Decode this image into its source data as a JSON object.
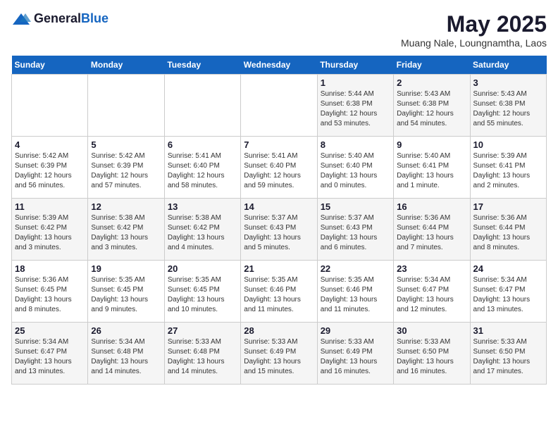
{
  "header": {
    "logo_general": "General",
    "logo_blue": "Blue",
    "title": "May 2025",
    "subtitle": "Muang Nale, Loungnamtha, Laos"
  },
  "weekdays": [
    "Sunday",
    "Monday",
    "Tuesday",
    "Wednesday",
    "Thursday",
    "Friday",
    "Saturday"
  ],
  "weeks": [
    [
      {
        "day": "",
        "sunrise": "",
        "sunset": "",
        "daylight": ""
      },
      {
        "day": "",
        "sunrise": "",
        "sunset": "",
        "daylight": ""
      },
      {
        "day": "",
        "sunrise": "",
        "sunset": "",
        "daylight": ""
      },
      {
        "day": "",
        "sunrise": "",
        "sunset": "",
        "daylight": ""
      },
      {
        "day": "1",
        "sunrise": "Sunrise: 5:44 AM",
        "sunset": "Sunset: 6:38 PM",
        "daylight": "Daylight: 12 hours and 53 minutes."
      },
      {
        "day": "2",
        "sunrise": "Sunrise: 5:43 AM",
        "sunset": "Sunset: 6:38 PM",
        "daylight": "Daylight: 12 hours and 54 minutes."
      },
      {
        "day": "3",
        "sunrise": "Sunrise: 5:43 AM",
        "sunset": "Sunset: 6:38 PM",
        "daylight": "Daylight: 12 hours and 55 minutes."
      }
    ],
    [
      {
        "day": "4",
        "sunrise": "Sunrise: 5:42 AM",
        "sunset": "Sunset: 6:39 PM",
        "daylight": "Daylight: 12 hours and 56 minutes."
      },
      {
        "day": "5",
        "sunrise": "Sunrise: 5:42 AM",
        "sunset": "Sunset: 6:39 PM",
        "daylight": "Daylight: 12 hours and 57 minutes."
      },
      {
        "day": "6",
        "sunrise": "Sunrise: 5:41 AM",
        "sunset": "Sunset: 6:40 PM",
        "daylight": "Daylight: 12 hours and 58 minutes."
      },
      {
        "day": "7",
        "sunrise": "Sunrise: 5:41 AM",
        "sunset": "Sunset: 6:40 PM",
        "daylight": "Daylight: 12 hours and 59 minutes."
      },
      {
        "day": "8",
        "sunrise": "Sunrise: 5:40 AM",
        "sunset": "Sunset: 6:40 PM",
        "daylight": "Daylight: 13 hours and 0 minutes."
      },
      {
        "day": "9",
        "sunrise": "Sunrise: 5:40 AM",
        "sunset": "Sunset: 6:41 PM",
        "daylight": "Daylight: 13 hours and 1 minute."
      },
      {
        "day": "10",
        "sunrise": "Sunrise: 5:39 AM",
        "sunset": "Sunset: 6:41 PM",
        "daylight": "Daylight: 13 hours and 2 minutes."
      }
    ],
    [
      {
        "day": "11",
        "sunrise": "Sunrise: 5:39 AM",
        "sunset": "Sunset: 6:42 PM",
        "daylight": "Daylight: 13 hours and 3 minutes."
      },
      {
        "day": "12",
        "sunrise": "Sunrise: 5:38 AM",
        "sunset": "Sunset: 6:42 PM",
        "daylight": "Daylight: 13 hours and 3 minutes."
      },
      {
        "day": "13",
        "sunrise": "Sunrise: 5:38 AM",
        "sunset": "Sunset: 6:42 PM",
        "daylight": "Daylight: 13 hours and 4 minutes."
      },
      {
        "day": "14",
        "sunrise": "Sunrise: 5:37 AM",
        "sunset": "Sunset: 6:43 PM",
        "daylight": "Daylight: 13 hours and 5 minutes."
      },
      {
        "day": "15",
        "sunrise": "Sunrise: 5:37 AM",
        "sunset": "Sunset: 6:43 PM",
        "daylight": "Daylight: 13 hours and 6 minutes."
      },
      {
        "day": "16",
        "sunrise": "Sunrise: 5:36 AM",
        "sunset": "Sunset: 6:44 PM",
        "daylight": "Daylight: 13 hours and 7 minutes."
      },
      {
        "day": "17",
        "sunrise": "Sunrise: 5:36 AM",
        "sunset": "Sunset: 6:44 PM",
        "daylight": "Daylight: 13 hours and 8 minutes."
      }
    ],
    [
      {
        "day": "18",
        "sunrise": "Sunrise: 5:36 AM",
        "sunset": "Sunset: 6:45 PM",
        "daylight": "Daylight: 13 hours and 8 minutes."
      },
      {
        "day": "19",
        "sunrise": "Sunrise: 5:35 AM",
        "sunset": "Sunset: 6:45 PM",
        "daylight": "Daylight: 13 hours and 9 minutes."
      },
      {
        "day": "20",
        "sunrise": "Sunrise: 5:35 AM",
        "sunset": "Sunset: 6:45 PM",
        "daylight": "Daylight: 13 hours and 10 minutes."
      },
      {
        "day": "21",
        "sunrise": "Sunrise: 5:35 AM",
        "sunset": "Sunset: 6:46 PM",
        "daylight": "Daylight: 13 hours and 11 minutes."
      },
      {
        "day": "22",
        "sunrise": "Sunrise: 5:35 AM",
        "sunset": "Sunset: 6:46 PM",
        "daylight": "Daylight: 13 hours and 11 minutes."
      },
      {
        "day": "23",
        "sunrise": "Sunrise: 5:34 AM",
        "sunset": "Sunset: 6:47 PM",
        "daylight": "Daylight: 13 hours and 12 minutes."
      },
      {
        "day": "24",
        "sunrise": "Sunrise: 5:34 AM",
        "sunset": "Sunset: 6:47 PM",
        "daylight": "Daylight: 13 hours and 13 minutes."
      }
    ],
    [
      {
        "day": "25",
        "sunrise": "Sunrise: 5:34 AM",
        "sunset": "Sunset: 6:47 PM",
        "daylight": "Daylight: 13 hours and 13 minutes."
      },
      {
        "day": "26",
        "sunrise": "Sunrise: 5:34 AM",
        "sunset": "Sunset: 6:48 PM",
        "daylight": "Daylight: 13 hours and 14 minutes."
      },
      {
        "day": "27",
        "sunrise": "Sunrise: 5:33 AM",
        "sunset": "Sunset: 6:48 PM",
        "daylight": "Daylight: 13 hours and 14 minutes."
      },
      {
        "day": "28",
        "sunrise": "Sunrise: 5:33 AM",
        "sunset": "Sunset: 6:49 PM",
        "daylight": "Daylight: 13 hours and 15 minutes."
      },
      {
        "day": "29",
        "sunrise": "Sunrise: 5:33 AM",
        "sunset": "Sunset: 6:49 PM",
        "daylight": "Daylight: 13 hours and 16 minutes."
      },
      {
        "day": "30",
        "sunrise": "Sunrise: 5:33 AM",
        "sunset": "Sunset: 6:50 PM",
        "daylight": "Daylight: 13 hours and 16 minutes."
      },
      {
        "day": "31",
        "sunrise": "Sunrise: 5:33 AM",
        "sunset": "Sunset: 6:50 PM",
        "daylight": "Daylight: 13 hours and 17 minutes."
      }
    ]
  ]
}
